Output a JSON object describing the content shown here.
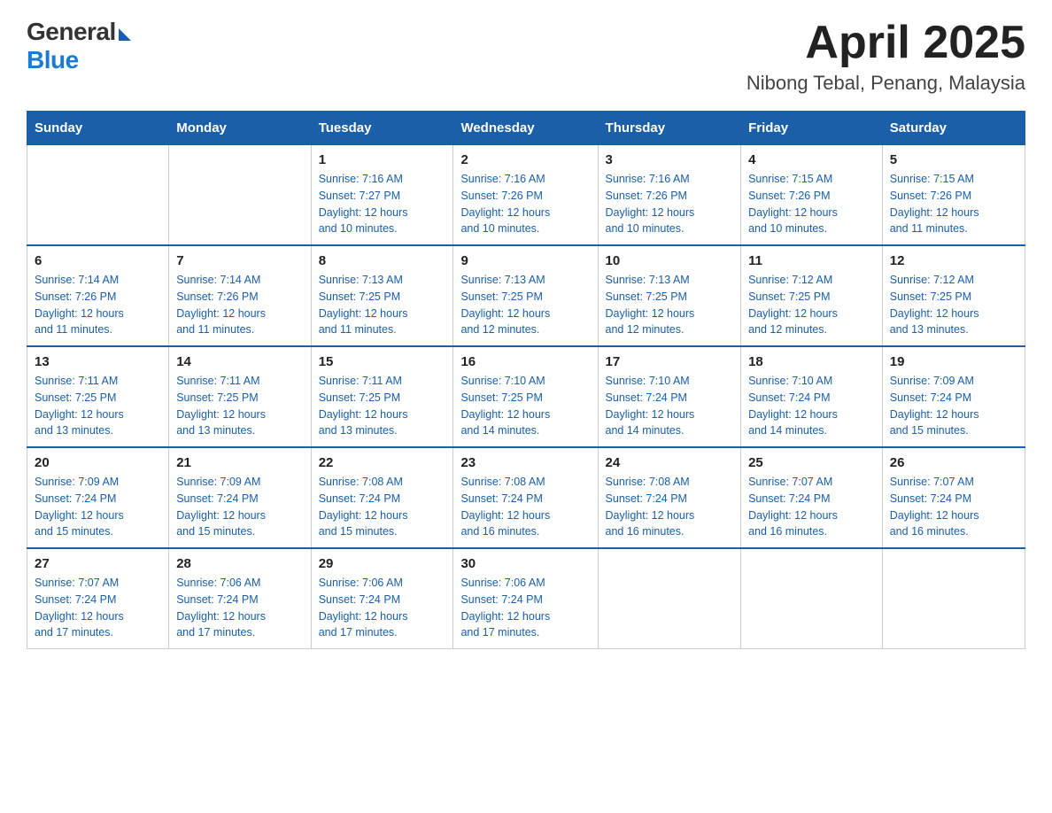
{
  "header": {
    "logo_general": "General",
    "logo_blue": "Blue",
    "title": "April 2025",
    "subtitle": "Nibong Tebal, Penang, Malaysia"
  },
  "calendar": {
    "days_of_week": [
      "Sunday",
      "Monday",
      "Tuesday",
      "Wednesday",
      "Thursday",
      "Friday",
      "Saturday"
    ],
    "weeks": [
      [
        {
          "day": "",
          "info": ""
        },
        {
          "day": "",
          "info": ""
        },
        {
          "day": "1",
          "info": "Sunrise: 7:16 AM\nSunset: 7:27 PM\nDaylight: 12 hours\nand 10 minutes."
        },
        {
          "day": "2",
          "info": "Sunrise: 7:16 AM\nSunset: 7:26 PM\nDaylight: 12 hours\nand 10 minutes."
        },
        {
          "day": "3",
          "info": "Sunrise: 7:16 AM\nSunset: 7:26 PM\nDaylight: 12 hours\nand 10 minutes."
        },
        {
          "day": "4",
          "info": "Sunrise: 7:15 AM\nSunset: 7:26 PM\nDaylight: 12 hours\nand 10 minutes."
        },
        {
          "day": "5",
          "info": "Sunrise: 7:15 AM\nSunset: 7:26 PM\nDaylight: 12 hours\nand 11 minutes."
        }
      ],
      [
        {
          "day": "6",
          "info": "Sunrise: 7:14 AM\nSunset: 7:26 PM\nDaylight: 12 hours\nand 11 minutes."
        },
        {
          "day": "7",
          "info": "Sunrise: 7:14 AM\nSunset: 7:26 PM\nDaylight: 12 hours\nand 11 minutes."
        },
        {
          "day": "8",
          "info": "Sunrise: 7:13 AM\nSunset: 7:25 PM\nDaylight: 12 hours\nand 11 minutes."
        },
        {
          "day": "9",
          "info": "Sunrise: 7:13 AM\nSunset: 7:25 PM\nDaylight: 12 hours\nand 12 minutes."
        },
        {
          "day": "10",
          "info": "Sunrise: 7:13 AM\nSunset: 7:25 PM\nDaylight: 12 hours\nand 12 minutes."
        },
        {
          "day": "11",
          "info": "Sunrise: 7:12 AM\nSunset: 7:25 PM\nDaylight: 12 hours\nand 12 minutes."
        },
        {
          "day": "12",
          "info": "Sunrise: 7:12 AM\nSunset: 7:25 PM\nDaylight: 12 hours\nand 13 minutes."
        }
      ],
      [
        {
          "day": "13",
          "info": "Sunrise: 7:11 AM\nSunset: 7:25 PM\nDaylight: 12 hours\nand 13 minutes."
        },
        {
          "day": "14",
          "info": "Sunrise: 7:11 AM\nSunset: 7:25 PM\nDaylight: 12 hours\nand 13 minutes."
        },
        {
          "day": "15",
          "info": "Sunrise: 7:11 AM\nSunset: 7:25 PM\nDaylight: 12 hours\nand 13 minutes."
        },
        {
          "day": "16",
          "info": "Sunrise: 7:10 AM\nSunset: 7:25 PM\nDaylight: 12 hours\nand 14 minutes."
        },
        {
          "day": "17",
          "info": "Sunrise: 7:10 AM\nSunset: 7:24 PM\nDaylight: 12 hours\nand 14 minutes."
        },
        {
          "day": "18",
          "info": "Sunrise: 7:10 AM\nSunset: 7:24 PM\nDaylight: 12 hours\nand 14 minutes."
        },
        {
          "day": "19",
          "info": "Sunrise: 7:09 AM\nSunset: 7:24 PM\nDaylight: 12 hours\nand 15 minutes."
        }
      ],
      [
        {
          "day": "20",
          "info": "Sunrise: 7:09 AM\nSunset: 7:24 PM\nDaylight: 12 hours\nand 15 minutes."
        },
        {
          "day": "21",
          "info": "Sunrise: 7:09 AM\nSunset: 7:24 PM\nDaylight: 12 hours\nand 15 minutes."
        },
        {
          "day": "22",
          "info": "Sunrise: 7:08 AM\nSunset: 7:24 PM\nDaylight: 12 hours\nand 15 minutes."
        },
        {
          "day": "23",
          "info": "Sunrise: 7:08 AM\nSunset: 7:24 PM\nDaylight: 12 hours\nand 16 minutes."
        },
        {
          "day": "24",
          "info": "Sunrise: 7:08 AM\nSunset: 7:24 PM\nDaylight: 12 hours\nand 16 minutes."
        },
        {
          "day": "25",
          "info": "Sunrise: 7:07 AM\nSunset: 7:24 PM\nDaylight: 12 hours\nand 16 minutes."
        },
        {
          "day": "26",
          "info": "Sunrise: 7:07 AM\nSunset: 7:24 PM\nDaylight: 12 hours\nand 16 minutes."
        }
      ],
      [
        {
          "day": "27",
          "info": "Sunrise: 7:07 AM\nSunset: 7:24 PM\nDaylight: 12 hours\nand 17 minutes."
        },
        {
          "day": "28",
          "info": "Sunrise: 7:06 AM\nSunset: 7:24 PM\nDaylight: 12 hours\nand 17 minutes."
        },
        {
          "day": "29",
          "info": "Sunrise: 7:06 AM\nSunset: 7:24 PM\nDaylight: 12 hours\nand 17 minutes."
        },
        {
          "day": "30",
          "info": "Sunrise: 7:06 AM\nSunset: 7:24 PM\nDaylight: 12 hours\nand 17 minutes."
        },
        {
          "day": "",
          "info": ""
        },
        {
          "day": "",
          "info": ""
        },
        {
          "day": "",
          "info": ""
        }
      ]
    ]
  }
}
